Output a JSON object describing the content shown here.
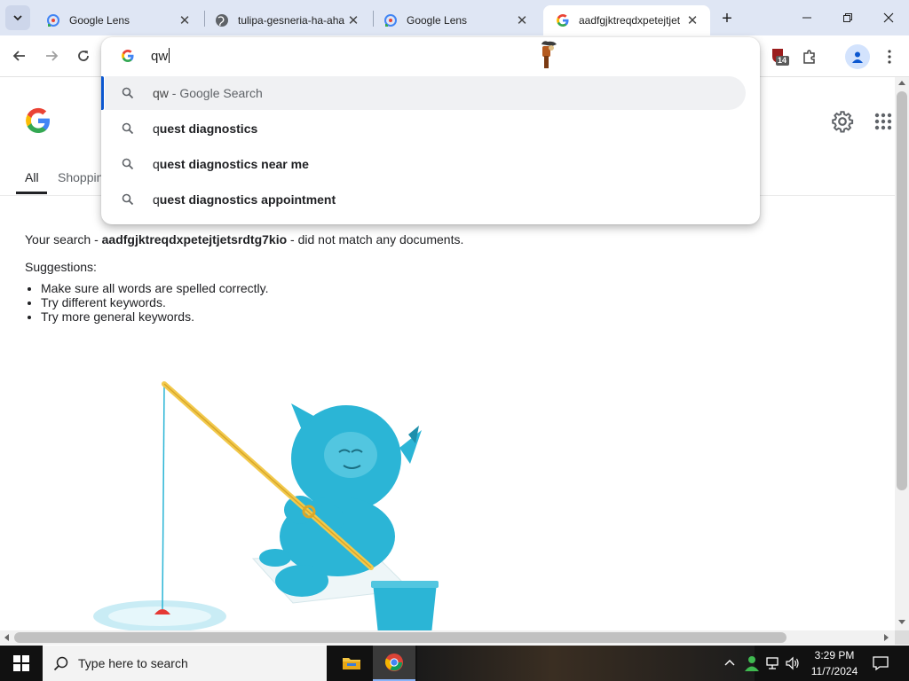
{
  "tabs": [
    {
      "title": "Google Lens",
      "favicon": "google-lens-icon",
      "active": false
    },
    {
      "title": "tulipa-gesneria-ha-aha",
      "favicon": "globe-icon",
      "active": false
    },
    {
      "title": "Google Lens",
      "favicon": "google-lens-icon",
      "active": false
    },
    {
      "title": "aadfgjktreqdxpetejtjet",
      "favicon": "google-g-icon",
      "active": true
    }
  ],
  "omnibox": {
    "input_value": "qw",
    "suggestions": [
      {
        "prefix": "qw",
        "rest": " - Google Search",
        "selected": true
      },
      {
        "prefix": "q",
        "rest": "uest diagnostics",
        "selected": false
      },
      {
        "prefix": "q",
        "rest": "uest diagnostics near me",
        "selected": false
      },
      {
        "prefix": "q",
        "rest": "uest diagnostics appointment",
        "selected": false
      }
    ]
  },
  "extensions": {
    "badge_count": "14"
  },
  "search_tabs": {
    "all": "All",
    "shopping": "Shoppin"
  },
  "no_results": {
    "prefix": "Your search - ",
    "query": "aadfgjktreqdxpetejtjetsrdtg7kio",
    "suffix": " - did not match any documents.",
    "suggestions_heading": "Suggestions:",
    "tips": [
      "Make sure all words are spelled correctly.",
      "Try different keywords.",
      "Try more general keywords."
    ]
  },
  "taskbar": {
    "search_placeholder": "Type here to search",
    "time": "3:29 PM",
    "date": "11/7/2024"
  },
  "colors": {
    "accent": "#0b57d0",
    "tabstrip": "#dfe6f4",
    "illustration": "#2bb5d6"
  }
}
